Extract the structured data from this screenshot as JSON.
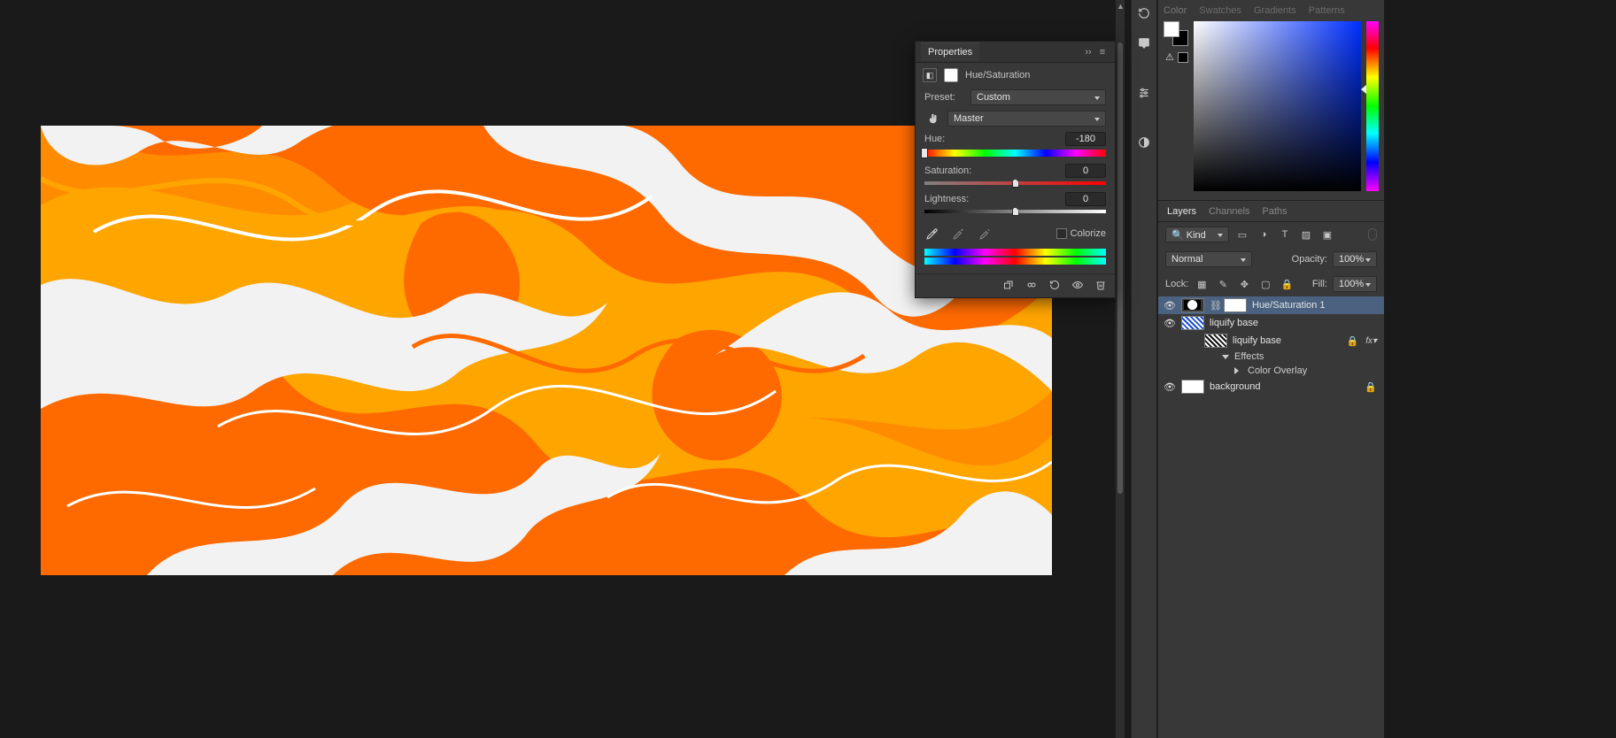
{
  "properties": {
    "tab": "Properties",
    "adjustment_name": "Hue/Saturation",
    "preset_label": "Preset:",
    "preset_value": "Custom",
    "range_value": "Master",
    "sliders": {
      "hue": {
        "label": "Hue:",
        "value": "-180",
        "pos": 0
      },
      "saturation": {
        "label": "Saturation:",
        "value": "0",
        "pos": 50
      },
      "lightness": {
        "label": "Lightness:",
        "value": "0",
        "pos": 50
      }
    },
    "colorize_label": "Colorize"
  },
  "color_panel": {
    "tabs": [
      "Color",
      "Swatches",
      "Gradients",
      "Patterns"
    ]
  },
  "layers_panel": {
    "tabs": [
      "Layers",
      "Channels",
      "Paths"
    ],
    "kind_label": "Kind",
    "blend_mode": "Normal",
    "opacity_label": "Opacity:",
    "opacity_value": "100%",
    "lock_label": "Lock:",
    "fill_label": "Fill:",
    "fill_value": "100%",
    "layers": [
      {
        "name": "Hue/Saturation 1"
      },
      {
        "name": "liquify base"
      },
      {
        "name": "liquify base"
      },
      {
        "name": "Effects"
      },
      {
        "name": "Color Overlay"
      },
      {
        "name": "background"
      }
    ]
  }
}
